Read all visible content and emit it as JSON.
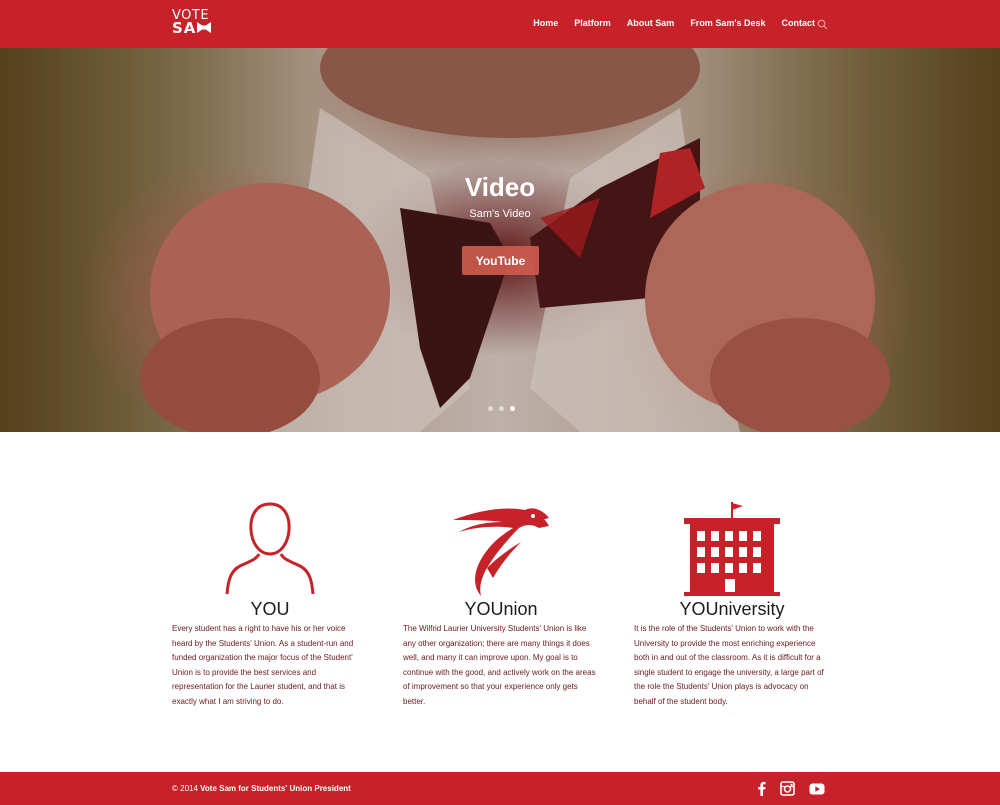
{
  "header": {
    "logo_line1": "VOTE",
    "logo_line2": "SA",
    "nav": [
      "Home",
      "Platform",
      "About Sam",
      "From Sam's Desk",
      "Contact"
    ]
  },
  "hero": {
    "title": "Video",
    "subtitle": "Sam's Video",
    "button": "YouTube",
    "slides": 3,
    "active_slide": 3
  },
  "columns": [
    {
      "icon": "person-icon",
      "title": "YOU",
      "text": "Every student has a right to have his or her voice heard by the Students' Union. As a student-run and funded organization the major focus of the Student' Union is to provide the best services and representation for the Laurier student, and that is exactly what I am striving to do."
    },
    {
      "icon": "hawk-icon",
      "title": "YOUnion",
      "text": "The Wilfrid Laurier University Students' Union is like any other organization; there are many things it does well, and many it can improve upon. My goal is to continue with the good, and actively work on the areas of improvement so that your experience only gets better."
    },
    {
      "icon": "building-icon",
      "title": "YOUniversity",
      "text": "It is the role of the Students' Union to work with the University to provide the most enriching experience both in and out of the classroom. As it is difficult for a single student to engage the university, a large part of the role the Students' Union plays is advocacy on behalf of the student body."
    }
  ],
  "footer": {
    "copyright": "© 2014",
    "site_name": "Vote Sam for Students' Union President",
    "social": [
      "facebook-icon",
      "instagram-icon",
      "youtube-icon"
    ]
  },
  "colors": {
    "brand_red": "#c7222a",
    "text_dark_red": "#6a1a1a",
    "button": "#cd5a4e"
  }
}
